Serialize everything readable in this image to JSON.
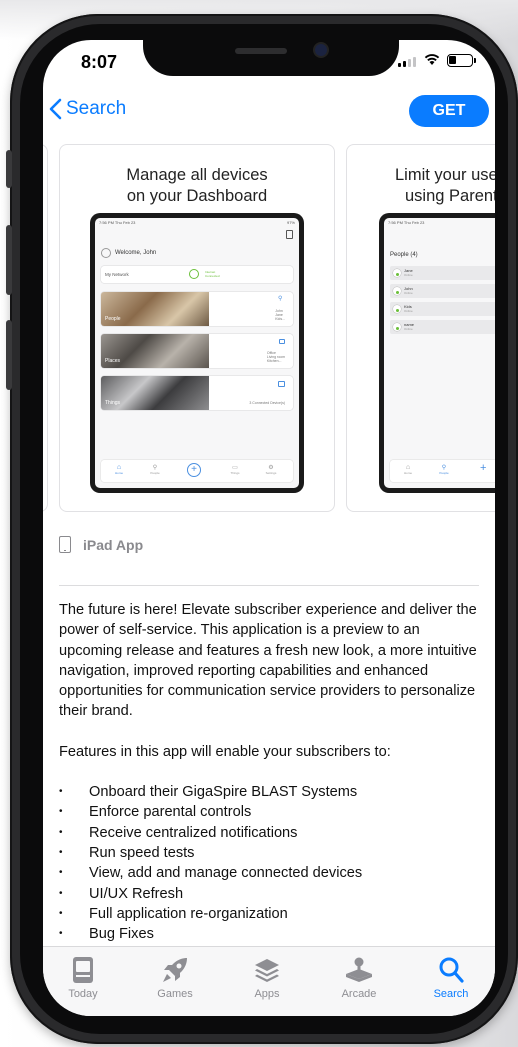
{
  "status_bar": {
    "time": "8:07"
  },
  "nav": {
    "back_label": "Search",
    "get_label": "GET"
  },
  "screenshots": [
    {
      "title_line1": "Manage all devices",
      "title_line2": "on your Dashboard",
      "status": "7:56 PM   Thu Feb 23",
      "battery": "97%",
      "welcome": "Welcome, John",
      "network_label": "My Network",
      "network_status_line1": "Internet",
      "network_status_line2": "Connected",
      "tiles": [
        {
          "label": "People",
          "note_line1": "John",
          "note_line2": "Jane",
          "note_line3": "Kids..."
        },
        {
          "label": "Places",
          "note_line1": "Office",
          "note_line2": "Living room",
          "note_line3": "Kitchen..."
        },
        {
          "label": "Things",
          "note_line1": "3 Connected Device(s)"
        }
      ],
      "tabs": [
        "Home",
        "People",
        "",
        "Things",
        "Settings"
      ]
    },
    {
      "title_line1": "Limit your use",
      "title_line2": "using Parent",
      "status": "7:56 PM   Thu Feb 23",
      "people_header": "People (4)",
      "people": [
        {
          "name": "Jane",
          "sub": "Online"
        },
        {
          "name": "John",
          "sub": "Online"
        },
        {
          "name": "Kids",
          "sub": "Online"
        },
        {
          "name": "name",
          "sub": "Online"
        }
      ],
      "tabs": [
        "Home",
        "People"
      ]
    }
  ],
  "ipad_app_label": "iPad App",
  "description": {
    "para1": "The future is here! Elevate subscriber experience and deliver the power of self-service. This application is a preview to an upcoming release and features a fresh new look, a more intuitive navigation, improved reporting capabilities and enhanced opportunities for communication service providers to personalize their brand.",
    "para2": "Features in this app will enable your subscribers to:",
    "features": [
      "Onboard their GigaSpire BLAST Systems",
      "Enforce parental controls",
      "Receive centralized notifications",
      "Run speed tests",
      "View, add and manage connected devices",
      "UI/UX Refresh",
      "Full application re-organization",
      "Bug Fixes"
    ]
  },
  "tabbar": [
    {
      "label": "Today",
      "icon": "today-icon",
      "active": false
    },
    {
      "label": "Games",
      "icon": "rocket-icon",
      "active": false
    },
    {
      "label": "Apps",
      "icon": "layers-icon",
      "active": false
    },
    {
      "label": "Arcade",
      "icon": "joystick-icon",
      "active": false
    },
    {
      "label": "Search",
      "icon": "search-icon",
      "active": true
    }
  ],
  "colors": {
    "accent": "#0a7cff",
    "inactive": "#8e8e93",
    "phone_frame": "#2a2a2c"
  }
}
